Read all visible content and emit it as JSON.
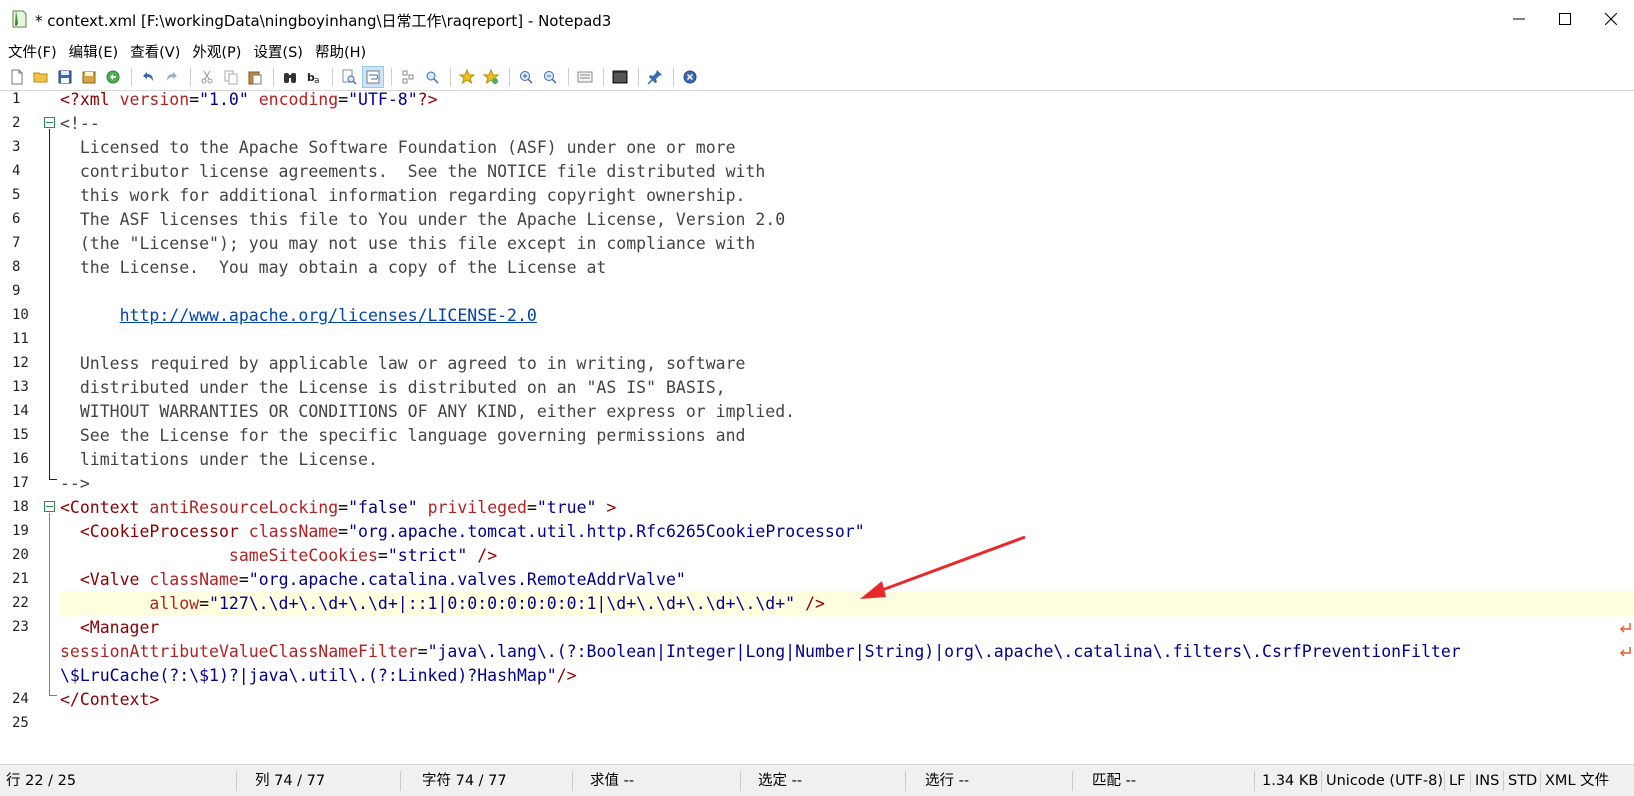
{
  "window": {
    "title": "* context.xml [F:\\workingData\\ningboyinhang\\日常工作\\raqreport] - Notepad3"
  },
  "menu": {
    "items": [
      "文件(F)",
      "编辑(E)",
      "查看(V)",
      "外观(P)",
      "设置(S)",
      "帮助(H)"
    ]
  },
  "toolbar": {
    "buttons": [
      "new-file",
      "open-file",
      "save",
      "save-as",
      "revert",
      "undo",
      "redo",
      "cut",
      "copy",
      "paste",
      "find",
      "replace",
      "find-in-files",
      "word-wrap",
      "view-whitespace",
      "zoom-in-view",
      "bookmark",
      "favorites",
      "zoom-in",
      "zoom-out",
      "toggle-panel",
      "view-source",
      "pin",
      "exit"
    ]
  },
  "editor": {
    "lines": [
      {
        "n": "1"
      },
      {
        "n": "2"
      },
      {
        "n": "3"
      },
      {
        "n": "4"
      },
      {
        "n": "5"
      },
      {
        "n": "6"
      },
      {
        "n": "7"
      },
      {
        "n": "8"
      },
      {
        "n": "9"
      },
      {
        "n": "10"
      },
      {
        "n": "11"
      },
      {
        "n": "12"
      },
      {
        "n": "13"
      },
      {
        "n": "14"
      },
      {
        "n": "15"
      },
      {
        "n": "16"
      },
      {
        "n": "17"
      },
      {
        "n": "18"
      },
      {
        "n": "19"
      },
      {
        "n": "20"
      },
      {
        "n": "21"
      },
      {
        "n": "22"
      },
      {
        "n": "23"
      },
      {
        "n": ""
      },
      {
        "n": ""
      },
      {
        "n": "24"
      },
      {
        "n": "25"
      }
    ],
    "code": {
      "l1_pi_open": "<?xml",
      "l1_attr1": "version",
      "l1_val1": "\"1.0\"",
      "l1_attr2": "encoding",
      "l1_val2": "\"UTF-8\"",
      "l1_pi_close": "?>",
      "l2": "<!--",
      "l3": "  Licensed to the Apache Software Foundation (ASF) under one or more",
      "l4": "  contributor license agreements.  See the NOTICE file distributed with",
      "l5": "  this work for additional information regarding copyright ownership.",
      "l6": "  The ASF licenses this file to You under the Apache License, Version 2.0",
      "l7": "  (the \"License\"); you may not use this file except in compliance with",
      "l8": "  the License.  You may obtain a copy of the License at",
      "l10_link": "http://www.apache.org/licenses/LICENSE-2.0",
      "l12": "  Unless required by applicable law or agreed to in writing, software",
      "l13": "  distributed under the License is distributed on an \"AS IS\" BASIS,",
      "l14": "  WITHOUT WARRANTIES OR CONDITIONS OF ANY KIND, either express or implied.",
      "l15": "  See the License for the specific language governing permissions and",
      "l16": "  limitations under the License.",
      "l17": "-->",
      "l18_tag": "<Context",
      "l18_attr1": "antiResourceLocking",
      "l18_val1": "\"false\"",
      "l18_attr2": "privileged",
      "l18_val2": "\"true\"",
      "l18_close": ">",
      "l19_tag": "<CookieProcessor",
      "l19_attr": "className",
      "l19_val": "\"org.apache.tomcat.util.http.Rfc6265CookieProcessor\"",
      "l20_attr": "sameSiteCookies",
      "l20_val": "\"strict\"",
      "l20_close": "/>",
      "l21_tag": "<Valve",
      "l21_attr": "className",
      "l21_val": "\"org.apache.catalina.valves.RemoteAddrValve\"",
      "l22_attr": "allow",
      "l22_val": "\"127\\.\\d+\\.\\d+\\.\\d+|::1|0:0:0:0:0:0:0:1|\\d+\\.\\d+\\.\\d+\\.\\d+\"",
      "l22_close": "/>",
      "l23_tag": "<Manager",
      "l23b_attr": "sessionAttributeValueClassNameFilter",
      "l23b_val": "\"java\\.lang\\.(?:Boolean|Integer|Long|Number|String)|org\\.apache\\.catalina\\.filters\\.CsrfPreventionFilter",
      "l23c_val": "\\$LruCache(?:\\$1)?|java\\.util\\.(?:Linked)?HashMap\"",
      "l23c_close": "/>",
      "l24": "</Context>"
    }
  },
  "status": {
    "line": "行 22 / 25",
    "col": "列 74 / 77",
    "char": "字符 74 / 77",
    "sum": "求值 --",
    "sel": "选定 --",
    "sel_lines": "选行 --",
    "match": "匹配 --",
    "size": "1.34 KB",
    "encoding": "Unicode (UTF-8)",
    "eol": "LF",
    "ins": "INS",
    "std": "STD",
    "lang": "XML 文件"
  },
  "colors": {
    "current_line": "#ffffe0",
    "fold_marker": "#2e8b57",
    "annotation_arrow": "#e8282b",
    "tag": "#8b0000",
    "value": "#00008b"
  }
}
